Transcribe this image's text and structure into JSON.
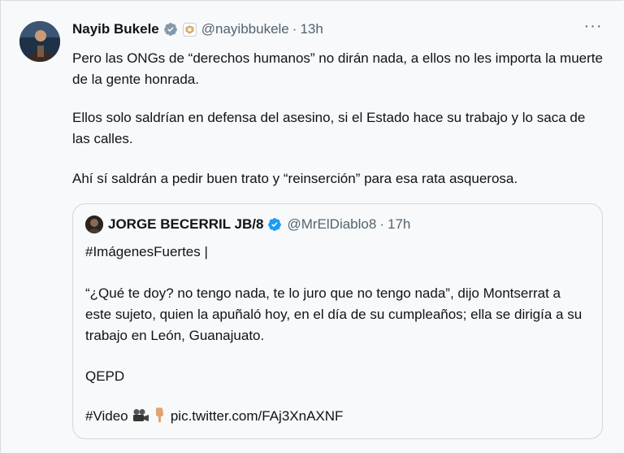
{
  "tweet": {
    "author_name": "Nayib Bukele",
    "author_handle": "@nayibbukele",
    "separator": "·",
    "time": "13h",
    "more": "···",
    "paragraphs": [
      "Pero las ONGs de “derechos humanos” no dirán nada, a ellos no les importa la muerte de la gente honrada.",
      "Ellos solo saldrían en defensa del asesino, si el Estado hace su trabajo y lo saca de las calles.",
      "Ahí sí saldrán a pedir buen trato y “reinserción” para esa rata asquerosa."
    ]
  },
  "quote": {
    "author_name": "JORGE BECERRIL JB/8",
    "author_handle": "@MrElDiablo8",
    "separator": "·",
    "time": "17h",
    "paragraphs": [
      "#ImágenesFuertes |",
      "“¿Qué te doy? no tengo nada, te lo juro que no tengo nada”, dijo Montserrat a este sujeto, quien la apuñaló hoy, en el día de su cumpleaños; ella se dirigía a su trabajo en León, Guanajuato.",
      "QEPD"
    ],
    "video_prefix": "#Video",
    "link": "pic.twitter.com/FAj3XnAXNF"
  },
  "icons": {
    "verified": "verified-badge-icon",
    "affiliate": "affiliate-badge-icon",
    "camera": "movie-camera-emoji",
    "point_down": "point-down-emoji"
  },
  "colors": {
    "verified_blue": "#1d9bf0",
    "secondary_text": "#536471",
    "border": "#cfd9de"
  }
}
